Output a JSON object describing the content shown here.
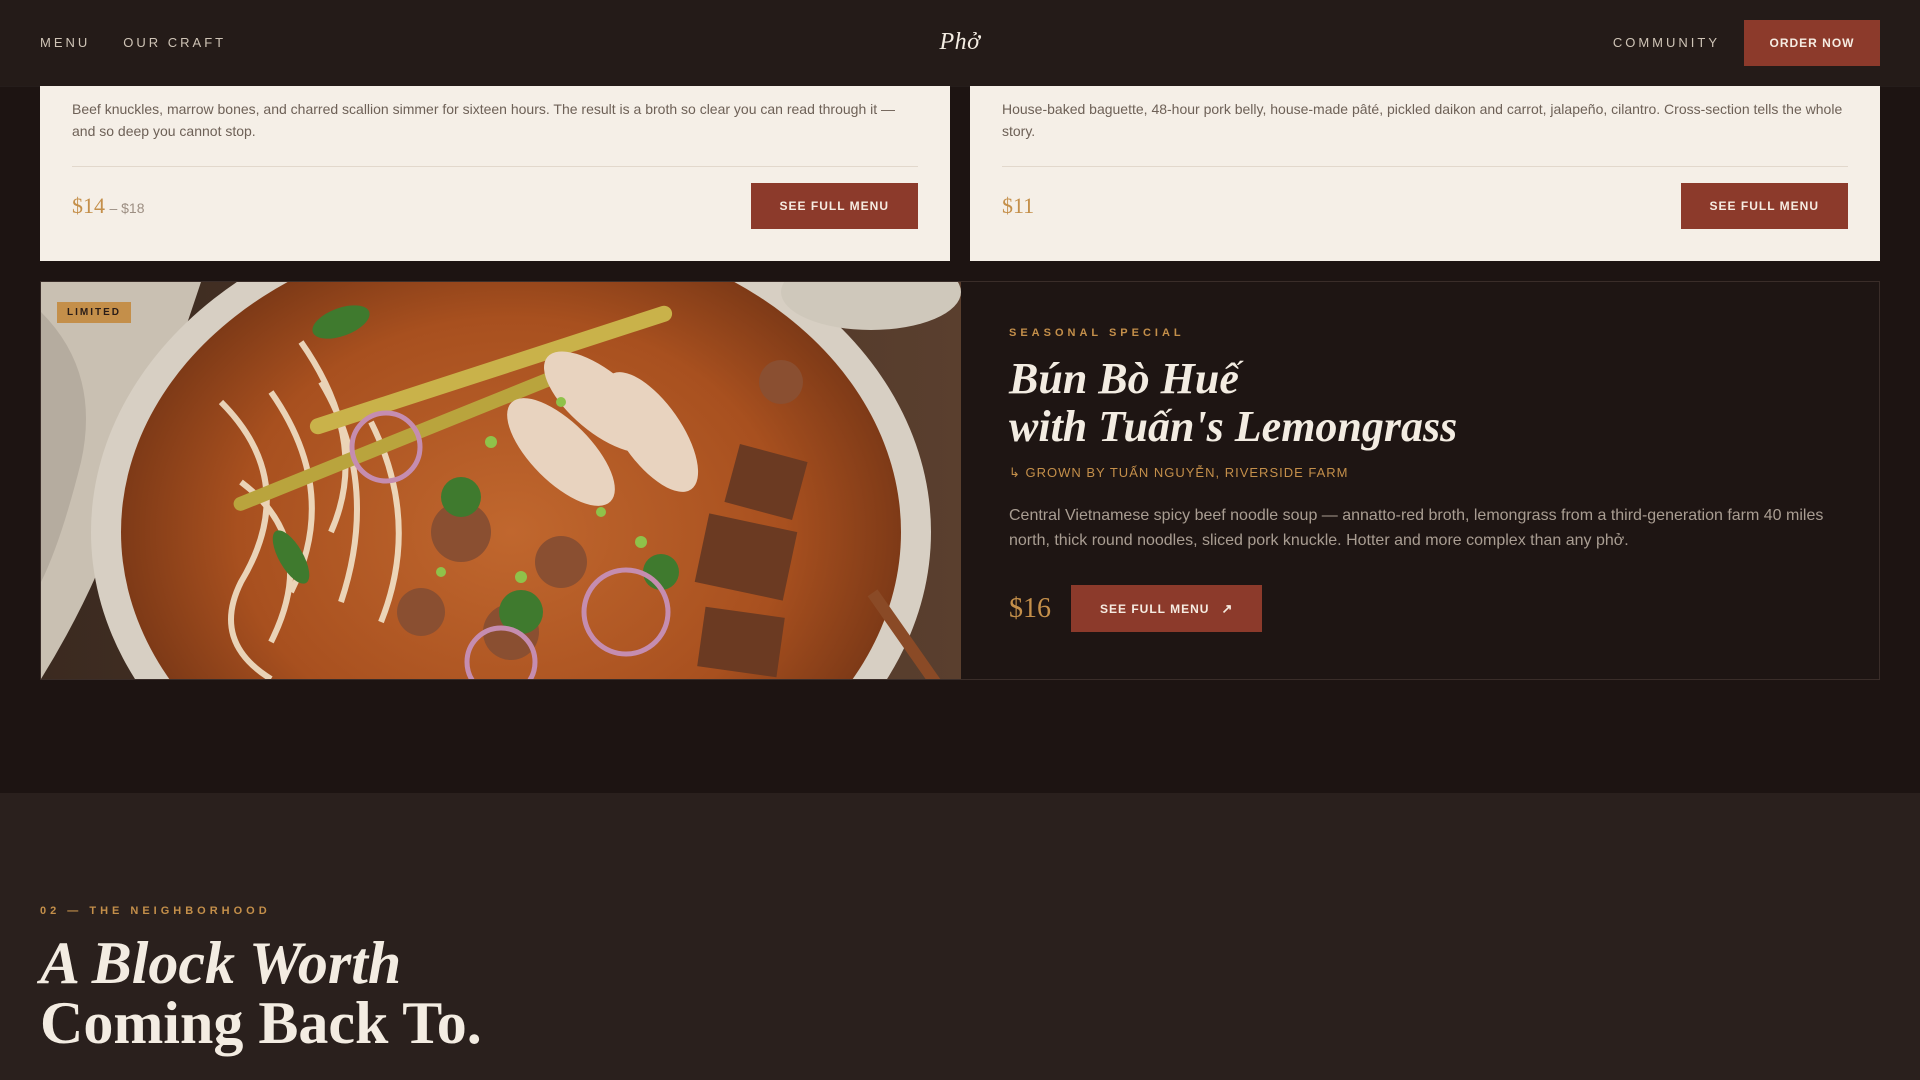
{
  "nav": {
    "links_left": [
      "MENU",
      "OUR CRAFT"
    ],
    "logo": "Phở",
    "community": "COMMUNITY",
    "order": "ORDER NOW"
  },
  "cards": [
    {
      "desc": "Beef knuckles, marrow bones, and charred scallion simmer for sixteen hours. The result is a broth so clear you can read through it — and so deep you cannot stop.",
      "price": "$14",
      "price_range": "– $18",
      "button": "SEE FULL MENU"
    },
    {
      "desc": "House-baked baguette, 48-hour pork belly, house-made pâté, pickled daikon and carrot, jalapeño, cilantro. Cross-section tells the whole story.",
      "price": "$11",
      "button": "SEE FULL MENU"
    }
  ],
  "seasonal": {
    "badge": "LIMITED",
    "eyebrow": "SEASONAL SPECIAL",
    "title_line1": "Bún Bò Huế",
    "title_line2": "with Tuấn's Lemongrass",
    "grown": "↳ GROWN BY TUẤN NGUYỄN, RIVERSIDE FARM",
    "desc": "Central Vietnamese spicy beef noodle soup — annatto-red broth, lemongrass from a third-generation farm 40 miles north, thick round noodles, sliced pork knuckle. Hotter and more complex than any phở.",
    "price": "$16",
    "button": "SEE FULL MENU",
    "arrow": "↗"
  },
  "neighborhood": {
    "eyebrow": "02 — THE NEIGHBORHOOD",
    "title_line1": "A Block Worth",
    "title_line2": "Coming Back To."
  },
  "colors": {
    "accent": "#8c3a2b",
    "gold": "#c48f4a",
    "bg_dark": "#1d1412",
    "card_bg": "#f5efe7"
  }
}
